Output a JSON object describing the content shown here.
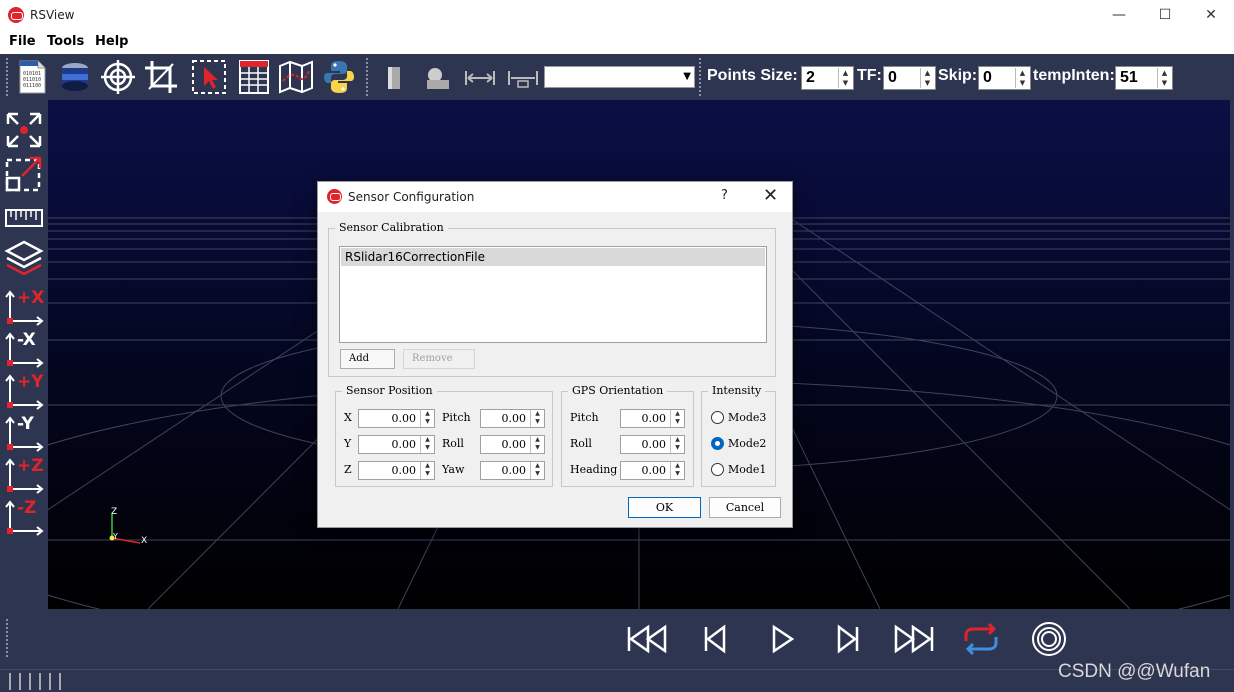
{
  "app": {
    "title": "RSView"
  },
  "window_controls": {
    "minimize": "—",
    "maximize": "☐",
    "close": "✕"
  },
  "menu": [
    "File",
    "Tools",
    "Help"
  ],
  "toolbar": {
    "icons": [
      "open-file-icon",
      "sensor-icon",
      "target-icon",
      "crop-icon",
      "select-icon",
      "spreadsheet-icon",
      "map-icon",
      "python-icon",
      "view-icon-1",
      "view-icon-2",
      "measure-icon-1",
      "measure-icon-2"
    ],
    "combo_value": "",
    "points_size_label": "Points Size:",
    "points_size_value": "2",
    "tf_label": "TF:",
    "tf_value": "0",
    "skip_label": "Skip:",
    "skip_value": "0",
    "temp_inten_label": "tempInten:",
    "temp_inten_value": "51"
  },
  "left_tools": [
    "reset-view-icon",
    "zoom-box-icon",
    "ruler-icon",
    "layers-icon",
    "view-plus-x-icon",
    "view-minus-x-icon",
    "view-plus-y-icon",
    "view-minus-y-icon",
    "view-plus-z-icon",
    "view-minus-z-icon"
  ],
  "left_tool_labels": [
    "+X",
    "-X",
    "+Y",
    "-Y",
    "+Z",
    "-Z"
  ],
  "axes": {
    "z": "Z",
    "y": "Y",
    "x": "X"
  },
  "dialog": {
    "title": "Sensor Configuration",
    "help": "?",
    "close": "✕",
    "calibration": {
      "title": "Sensor Calibration",
      "items": [
        "RSlidar16CorrectionFile"
      ],
      "add_label": "Add",
      "remove_label": "Remove"
    },
    "position": {
      "title": "Sensor Position",
      "fields": [
        {
          "label": "X",
          "value": "0.00"
        },
        {
          "label": "Y",
          "value": "0.00"
        },
        {
          "label": "Z",
          "value": "0.00"
        },
        {
          "label": "Pitch",
          "value": "0.00"
        },
        {
          "label": "Roll",
          "value": "0.00"
        },
        {
          "label": "Yaw",
          "value": "0.00"
        }
      ]
    },
    "gps": {
      "title": "GPS Orientation",
      "fields": [
        {
          "label": "Pitch",
          "value": "0.00"
        },
        {
          "label": "Roll",
          "value": "0.00"
        },
        {
          "label": "Heading",
          "value": "0.00"
        }
      ]
    },
    "intensity": {
      "title": "Intensity",
      "options": [
        "Mode3",
        "Mode2",
        "Mode1"
      ],
      "selected": "Mode2"
    },
    "ok_label": "OK",
    "cancel_label": "Cancel"
  },
  "watermark": "CSDN @@Wufan",
  "colors": {
    "toolbar_bg": "#2d3550",
    "viewport_top": "#0b0f45",
    "viewport_bottom": "#000000",
    "accent_red": "#e0242b",
    "accent_blue": "#0067c0"
  }
}
